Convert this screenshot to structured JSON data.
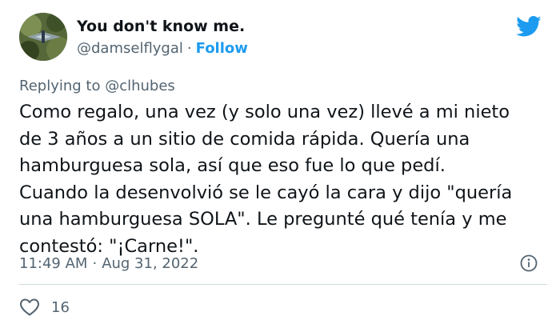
{
  "tweet": {
    "author_name": "You don't know me.",
    "author_handle": "@damselflygal",
    "separator": "·",
    "follow_label": "Follow",
    "replying_prefix": "Replying to",
    "replying_to": "@clhubes",
    "text": "Como regalo, una vez (y solo una vez) llevé a mi nieto\nde 3 años a un sitio de comida rápida. Quería una\nhamburguesa sola, así que eso fue lo que pedí.\nCuando la desenvolvió se le cayó la cara y dijo \"quería\nuna hamburguesa SOLA\".  Le pregunté qué tenía y me\ncontestó: \"¡Carne!\".",
    "time": "11:49 AM",
    "date": "Aug 31, 2022",
    "like_count": "16"
  },
  "icons": {
    "brand": "twitter-bird-icon",
    "info": "info-icon",
    "like": "heart-icon"
  },
  "colors": {
    "accent": "#1d9bf0",
    "text": "#0f1419",
    "secondary": "#536471",
    "divider": "#cfd9de"
  }
}
